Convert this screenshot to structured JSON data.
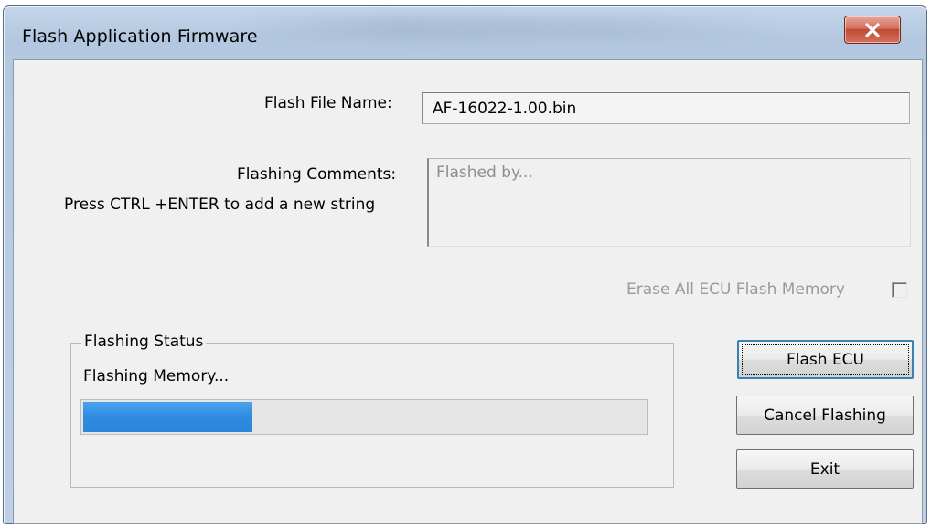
{
  "window": {
    "title": "Flash Application Firmware",
    "close_icon": "close-x-icon"
  },
  "form": {
    "file_name_label": "Flash File Name:",
    "file_name_value": "AF-16022-1.00.bin",
    "comments_label": "Flashing Comments:",
    "comments_hint": "Press CTRL +ENTER to add a new string",
    "comments_placeholder": "Flashed by...",
    "erase_label": "Erase All ECU Flash Memory",
    "erase_checked": false
  },
  "status": {
    "group_label": "Flashing Status",
    "message": "Flashing Memory...",
    "progress_fraction": 0.3
  },
  "buttons": {
    "flash": "Flash ECU",
    "cancel": "Cancel Flashing",
    "exit": "Exit"
  },
  "colors": {
    "progress_fill": "#2e8be0",
    "close_button": "#c14a34"
  }
}
